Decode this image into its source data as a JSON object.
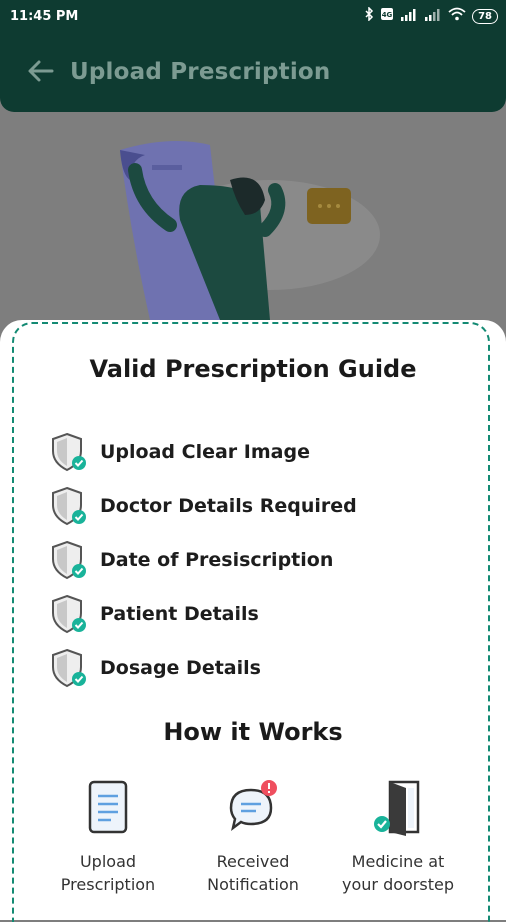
{
  "status_bar": {
    "time": "11:45 PM",
    "battery": "78",
    "icons": [
      "bluetooth-icon",
      "volte-icon",
      "signal-icon",
      "signal-icon",
      "wifi-icon",
      "battery-icon"
    ]
  },
  "app_bar": {
    "title": "Upload Prescription",
    "back_icon": "back-arrow-icon"
  },
  "guide": {
    "title": "Valid Prescription Guide",
    "items": [
      {
        "label": "Upload Clear Image"
      },
      {
        "label": "Doctor Details Required"
      },
      {
        "label": "Date of Presiscription"
      },
      {
        "label": "Patient Details"
      },
      {
        "label": "Dosage Details"
      }
    ]
  },
  "how_it_works": {
    "title": "How it Works",
    "steps": [
      {
        "label_line1": "Upload",
        "label_line2": "Prescription",
        "icon": "document-icon"
      },
      {
        "label_line1": "Received",
        "label_line2": "Notification",
        "icon": "chat-notification-icon"
      },
      {
        "label_line1": "Medicine at",
        "label_line2": "your doorstep",
        "icon": "door-icon"
      }
    ]
  },
  "colors": {
    "brand_dark": "#0e3b31",
    "accent": "#138a73",
    "check": "#19b39a"
  }
}
